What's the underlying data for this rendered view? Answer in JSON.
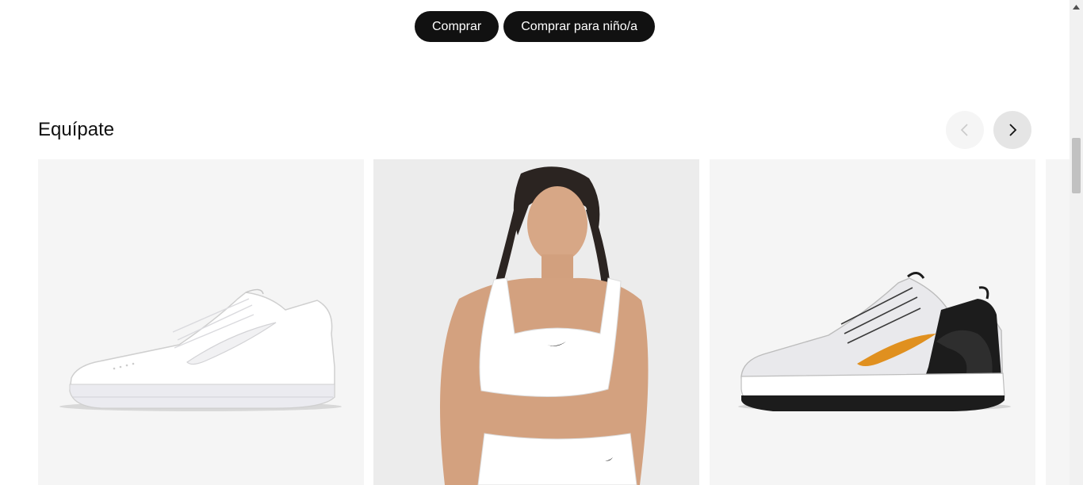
{
  "cta": {
    "shop_label": "Comprar",
    "shop_kids_label": "Comprar para niño/a"
  },
  "section": {
    "title": "Equípate"
  },
  "carousel": {
    "prev_icon": "chevron-left-icon",
    "next_icon": "chevron-right-icon",
    "prev_enabled": false,
    "next_enabled": true,
    "items": [
      {
        "image": "white-sneaker-image"
      },
      {
        "image": "white-sports-bra-image"
      },
      {
        "image": "grey-black-orange-training-shoe-image"
      },
      {
        "image": "partial-product-image"
      }
    ]
  },
  "colors": {
    "pill_bg": "#111111",
    "card_bg": "#f5f5f5",
    "swoosh_orange": "#e0901f"
  }
}
